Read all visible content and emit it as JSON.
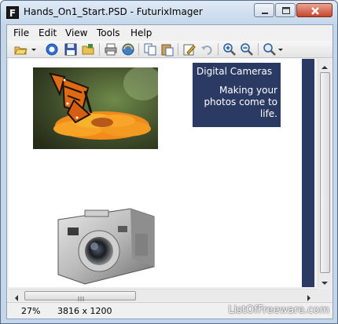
{
  "window": {
    "title": "Hands_On1_Start.PSD - FuturixImager",
    "app_icon_letter": "F"
  },
  "menu": {
    "items": [
      "File",
      "Edit",
      "View",
      "Tools",
      "Help"
    ]
  },
  "toolbar": {
    "buttons": [
      "open-icon",
      "dropdown-icon",
      "refresh-icon",
      "save-icon",
      "folder-icon",
      "print-icon",
      "scan-icon",
      "copy-icon",
      "paste-icon",
      "edit-icon",
      "undo-icon",
      "zoom-in-icon",
      "zoom-out-icon",
      "zoom-menu-icon"
    ]
  },
  "document": {
    "banner_heading": "Digital Cameras",
    "banner_tagline": "Making your photos come to life.",
    "banner_color": "#2b3a63"
  },
  "status": {
    "zoom": "27%",
    "dimensions": "3816 x 1200",
    "watermark": "ListOfFreeware.com"
  }
}
